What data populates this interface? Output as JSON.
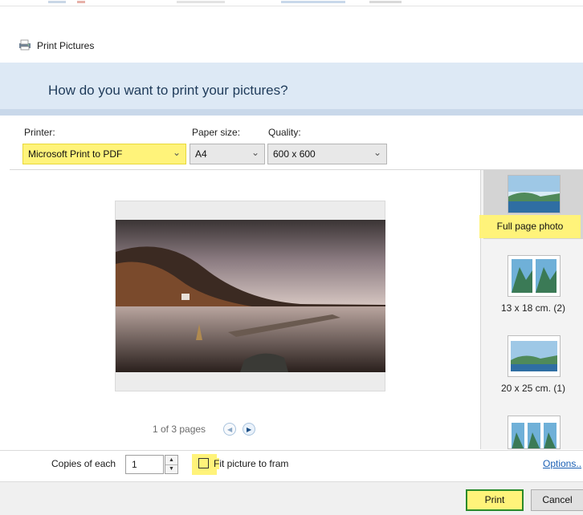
{
  "window": {
    "title": "Print Pictures",
    "icon": "printer-icon"
  },
  "header": {
    "question": "How do you want to print your pictures?"
  },
  "printer": {
    "label": "Printer:",
    "value": "Microsoft Print to PDF"
  },
  "paper_size": {
    "label": "Paper size:",
    "value": "A4"
  },
  "quality": {
    "label": "Quality:",
    "value": "600 x 600"
  },
  "preview": {
    "page_count": "1 of 3 pages"
  },
  "layouts": [
    {
      "label": "Full page photo",
      "selected": true
    },
    {
      "label": "13 x 18 cm. (2)"
    },
    {
      "label": "20 x 25 cm. (1)"
    },
    {
      "label": ""
    }
  ],
  "copies": {
    "label": "Copies of each",
    "value": "1"
  },
  "fit": {
    "label_first": "F",
    "label_rest": "it picture to fram",
    "checked": false
  },
  "options_link": "Options..",
  "buttons": {
    "print": "Print",
    "cancel": "Cancel"
  },
  "colors": {
    "highlight": "#fff37a",
    "header_band": "#dde9f5",
    "print_border": "#2b8a2b"
  }
}
